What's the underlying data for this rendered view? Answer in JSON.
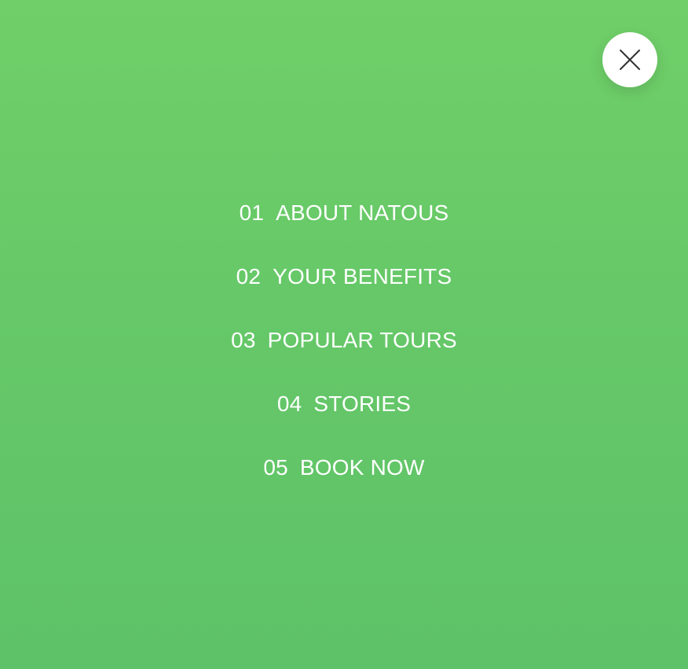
{
  "colors": {
    "background_top": "#70cf68",
    "background_bottom": "#5ec268",
    "text": "#ffffff",
    "close_button_bg": "#ffffff",
    "close_icon": "#333333"
  },
  "close_button": {
    "icon": "close-icon"
  },
  "menu": {
    "items": [
      {
        "number": "01",
        "label": "ABOUT NATOUS"
      },
      {
        "number": "02",
        "label": "YOUR BENEFITS"
      },
      {
        "number": "03",
        "label": "POPULAR TOURS"
      },
      {
        "number": "04",
        "label": "STORIES"
      },
      {
        "number": "05",
        "label": "BOOK NOW"
      }
    ]
  }
}
